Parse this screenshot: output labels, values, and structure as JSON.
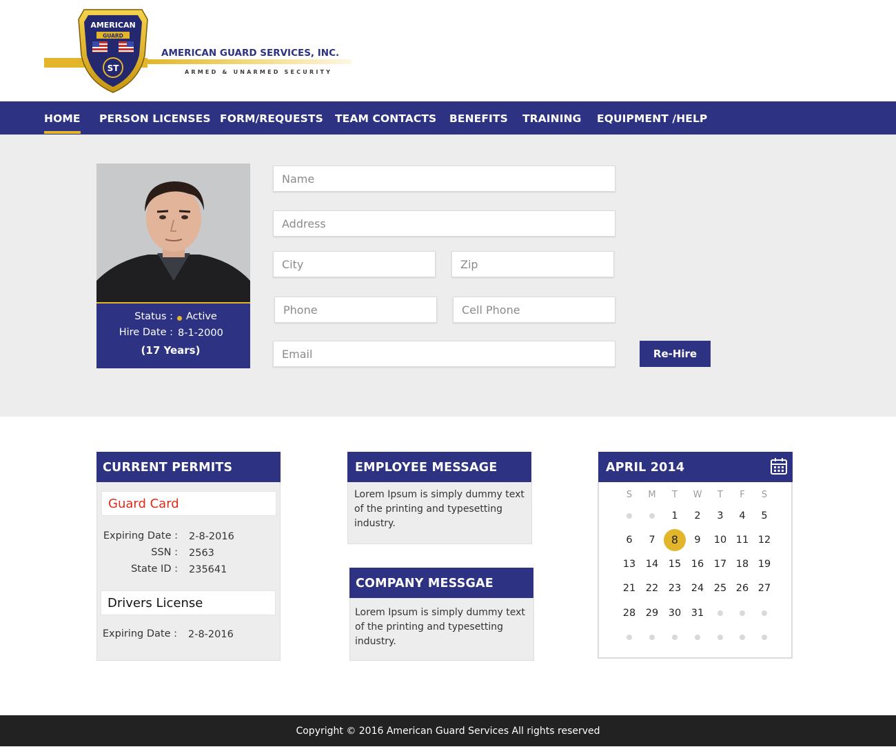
{
  "colors": {
    "brand_navy": "#2d3282",
    "accent_gold": "#e2b52b",
    "permit_red": "#e2291a",
    "section_gray": "#eeedee",
    "footer_dark": "#222222"
  },
  "logo": {
    "seal_top_text": "AMERICAN",
    "seal_banner_text": "GUARD",
    "seal_center_text": "ST",
    "company_name": "AMERICAN GUARD SERVICES, INC.",
    "tagline": "ARMED & UNARMED SECURITY"
  },
  "nav": {
    "items": [
      {
        "label": "HOME",
        "active": true
      },
      {
        "label": "PERSON LICENSES"
      },
      {
        "label": "FORM/REQUESTS"
      },
      {
        "label": "TEAM CONTACTS"
      },
      {
        "label": "BENEFITS"
      },
      {
        "label": "TRAINING"
      },
      {
        "label": "EQUIPMENT /HELP"
      }
    ]
  },
  "profile": {
    "status_label": "Status :",
    "status_value": "Active",
    "hire_label": "Hire Date :",
    "hire_value": "8-1-2000",
    "tenure": "(17 Years)"
  },
  "form": {
    "name_placeholder": "Name",
    "address_placeholder": "Address",
    "city_placeholder": "City",
    "zip_placeholder": "Zip",
    "phone_placeholder": "Phone",
    "cell_placeholder": "Cell Phone",
    "email_placeholder": "Email",
    "rehire_label": "Re-Hire"
  },
  "permits": {
    "title": "CURRENT PERMITS",
    "guard_card": {
      "title": "Guard Card",
      "expiring_label": "Expiring Date :",
      "expiring_value": "2-8-2016",
      "ssn_label": "SSN :",
      "ssn_value": "2563",
      "state_label": "State ID :",
      "state_value": "235641"
    },
    "drivers_license": {
      "title": "Drivers License",
      "expiring_label": "Expiring Date :",
      "expiring_value": "2-8-2016"
    }
  },
  "employee_message": {
    "title": "EMPLOYEE MESSAGE",
    "lines": [
      "Lorem Ipsum is simply dummy text",
      "of the printing and typesetting",
      "industry."
    ]
  },
  "company_message": {
    "title": "COMPANY MESSGAE",
    "lines": [
      "Lorem Ipsum is simply dummy text",
      "of the printing and typesetting",
      "industry."
    ]
  },
  "calendar": {
    "title": "APRIL 2014",
    "icon": "calendar-icon",
    "weekdays": [
      "S",
      "M",
      "T",
      "W",
      "T",
      "F",
      "S"
    ],
    "today": 8,
    "weeks": [
      [
        "",
        "",
        "1",
        "2",
        "3",
        "4",
        "5"
      ],
      [
        "6",
        "7",
        "8",
        "9",
        "10",
        "11",
        "12"
      ],
      [
        "13",
        "14",
        "15",
        "16",
        "17",
        "18",
        "19"
      ],
      [
        "21",
        "22",
        "23",
        "24",
        "25",
        "26",
        "27"
      ],
      [
        "28",
        "29",
        "30",
        "31",
        "",
        "",
        ""
      ],
      [
        "",
        "",
        "",
        "",
        "",
        "",
        ""
      ]
    ]
  },
  "footer": {
    "text": "Copyright © 2016 American Guard Services  All rights reserved"
  }
}
